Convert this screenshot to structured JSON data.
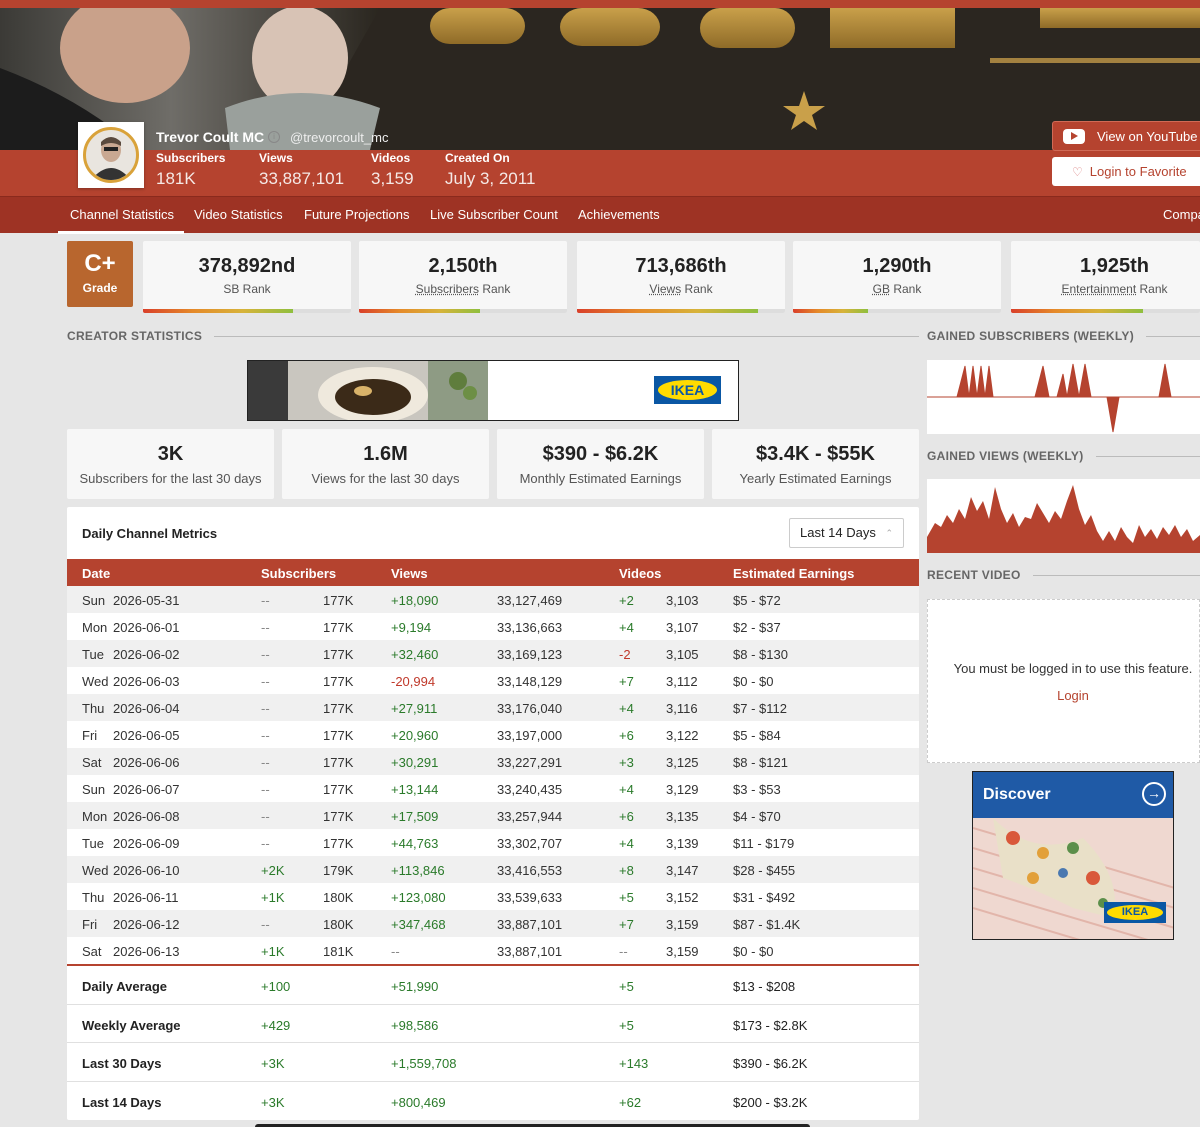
{
  "channel": {
    "name": "Trevor Coult MC",
    "handle": "@trevorcoult_mc",
    "stats": [
      {
        "label": "Subscribers",
        "value": "181K"
      },
      {
        "label": "Views",
        "value": "33,887,101"
      },
      {
        "label": "Videos",
        "value": "3,159"
      },
      {
        "label": "Created On",
        "value": "July 3, 2011"
      }
    ],
    "youtube_button": "View on YouTube",
    "favorite_button": "Login to Favorite"
  },
  "nav": {
    "tabs": [
      "Channel Statistics",
      "Video Statistics",
      "Future Projections",
      "Live Subscriber Count",
      "Achievements",
      "Compa"
    ]
  },
  "grade": {
    "value": "C+",
    "label": "Grade"
  },
  "ranks": [
    {
      "value": "378,892nd",
      "pre": "",
      "link": "",
      "post": "SB Rank",
      "bar_fraction": 0.72
    },
    {
      "value": "2,150th",
      "pre": "",
      "link": "Subscribers",
      "post": " Rank",
      "bar_fraction": 0.58
    },
    {
      "value": "713,686th",
      "pre": "",
      "link": "Views",
      "post": " Rank",
      "bar_fraction": 0.87
    },
    {
      "value": "1,290th",
      "pre": "",
      "link": "GB",
      "post": " Rank",
      "bar_fraction": 0.36
    },
    {
      "value": "1,925th",
      "pre": "",
      "link": "Entertainment",
      "post": " Rank",
      "bar_fraction": 0.7
    }
  ],
  "sections": {
    "creator": "CREATOR STATISTICS",
    "gained_subs": "GAINED SUBSCRIBERS (WEEKLY)",
    "gained_views": "GAINED VIEWS (WEEKLY)",
    "recent_video": "RECENT VIDEO"
  },
  "ad": {
    "brand": "IKEA"
  },
  "summary": [
    {
      "value": "3K",
      "label": "Subscribers for the last 30 days"
    },
    {
      "value": "1.6M",
      "label": "Views for the last 30 days"
    },
    {
      "value": "$390 - $6.2K",
      "label": "Monthly Estimated Earnings"
    },
    {
      "value": "$3.4K - $55K",
      "label": "Yearly Estimated Earnings"
    }
  ],
  "metrics": {
    "title": "Daily Channel Metrics",
    "range_select": "Last 14 Days",
    "headers": [
      "Date",
      "Subscribers",
      "Views",
      "Videos",
      "Estimated Earnings"
    ],
    "rows": [
      {
        "day": "Sun",
        "date": "2026-05-31",
        "sub_delta": "--",
        "subs": "177K",
        "view_delta": "+18,090",
        "views": "33,127,469",
        "vid_delta": "+2",
        "videos": "3,103",
        "earnings": "$5 - $72"
      },
      {
        "day": "Mon",
        "date": "2026-06-01",
        "sub_delta": "--",
        "subs": "177K",
        "view_delta": "+9,194",
        "views": "33,136,663",
        "vid_delta": "+4",
        "videos": "3,107",
        "earnings": "$2 - $37"
      },
      {
        "day": "Tue",
        "date": "2026-06-02",
        "sub_delta": "--",
        "subs": "177K",
        "view_delta": "+32,460",
        "views": "33,169,123",
        "vid_delta": "-2",
        "videos": "3,105",
        "earnings": "$8 - $130"
      },
      {
        "day": "Wed",
        "date": "2026-06-03",
        "sub_delta": "--",
        "subs": "177K",
        "view_delta": "-20,994",
        "views": "33,148,129",
        "vid_delta": "+7",
        "videos": "3,112",
        "earnings": "$0 - $0"
      },
      {
        "day": "Thu",
        "date": "2026-06-04",
        "sub_delta": "--",
        "subs": "177K",
        "view_delta": "+27,911",
        "views": "33,176,040",
        "vid_delta": "+4",
        "videos": "3,116",
        "earnings": "$7 - $112"
      },
      {
        "day": "Fri",
        "date": "2026-06-05",
        "sub_delta": "--",
        "subs": "177K",
        "view_delta": "+20,960",
        "views": "33,197,000",
        "vid_delta": "+6",
        "videos": "3,122",
        "earnings": "$5 - $84"
      },
      {
        "day": "Sat",
        "date": "2026-06-06",
        "sub_delta": "--",
        "subs": "177K",
        "view_delta": "+30,291",
        "views": "33,227,291",
        "vid_delta": "+3",
        "videos": "3,125",
        "earnings": "$8 - $121"
      },
      {
        "day": "Sun",
        "date": "2026-06-07",
        "sub_delta": "--",
        "subs": "177K",
        "view_delta": "+13,144",
        "views": "33,240,435",
        "vid_delta": "+4",
        "videos": "3,129",
        "earnings": "$3 - $53"
      },
      {
        "day": "Mon",
        "date": "2026-06-08",
        "sub_delta": "--",
        "subs": "177K",
        "view_delta": "+17,509",
        "views": "33,257,944",
        "vid_delta": "+6",
        "videos": "3,135",
        "earnings": "$4 - $70"
      },
      {
        "day": "Tue",
        "date": "2026-06-09",
        "sub_delta": "--",
        "subs": "177K",
        "view_delta": "+44,763",
        "views": "33,302,707",
        "vid_delta": "+4",
        "videos": "3,139",
        "earnings": "$11 - $179"
      },
      {
        "day": "Wed",
        "date": "2026-06-10",
        "sub_delta": "+2K",
        "subs": "179K",
        "view_delta": "+113,846",
        "views": "33,416,553",
        "vid_delta": "+8",
        "videos": "3,147",
        "earnings": "$28 - $455"
      },
      {
        "day": "Thu",
        "date": "2026-06-11",
        "sub_delta": "+1K",
        "subs": "180K",
        "view_delta": "+123,080",
        "views": "33,539,633",
        "vid_delta": "+5",
        "videos": "3,152",
        "earnings": "$31 - $492"
      },
      {
        "day": "Fri",
        "date": "2026-06-12",
        "sub_delta": "--",
        "subs": "180K",
        "view_delta": "+347,468",
        "views": "33,887,101",
        "vid_delta": "+7",
        "videos": "3,159",
        "earnings": "$87 - $1.4K"
      },
      {
        "day": "Sat",
        "date": "2026-06-13",
        "sub_delta": "+1K",
        "subs": "181K",
        "view_delta": "--",
        "views": "33,887,101",
        "vid_delta": "--",
        "videos": "3,159",
        "earnings": "$0 - $0"
      }
    ],
    "averages": [
      {
        "label": "Daily Average",
        "subs": "+100",
        "views": "+51,990",
        "videos": "+5",
        "earnings": "$13 - $208"
      },
      {
        "label": "Weekly Average",
        "subs": "+429",
        "views": "+98,586",
        "videos": "+5",
        "earnings": "$173 - $2.8K"
      },
      {
        "label": "Last 30 Days",
        "subs": "+3K",
        "views": "+1,559,708",
        "videos": "+143",
        "earnings": "$390 - $6.2K"
      },
      {
        "label": "Last 14 Days",
        "subs": "+3K",
        "views": "+800,469",
        "videos": "+62",
        "earnings": "$200 - $3.2K"
      }
    ]
  },
  "recent_video": {
    "message": "You must be logged in to use this feature.",
    "login_link": "Login"
  },
  "discover": {
    "title": "Discover",
    "brand": "IKEA"
  },
  "colors": {
    "accent": "#b5432f",
    "nav": "#9e3324",
    "positive": "#2a7a2a",
    "negative": "#c0392b",
    "chart_fill": "#b5432f"
  }
}
